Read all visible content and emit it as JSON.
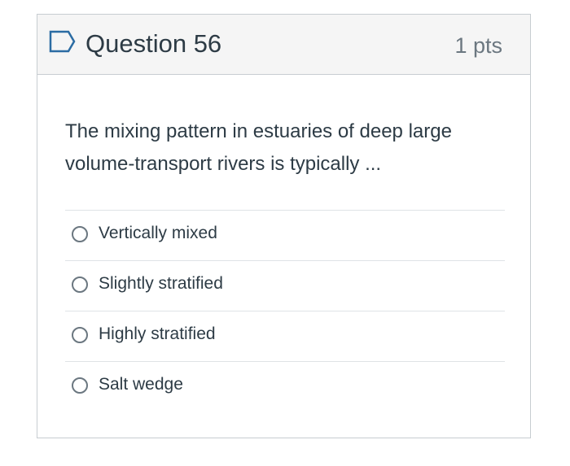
{
  "question": {
    "title": "Question 56",
    "points": "1 pts",
    "flag_icon": "bookmark-flag-icon",
    "text": "The mixing pattern in estuaries of deep large volume-transport rivers is typically ...",
    "answers": [
      {
        "label": "Vertically mixed",
        "selected": false
      },
      {
        "label": "Slightly stratified",
        "selected": false
      },
      {
        "label": "Highly stratified",
        "selected": false
      },
      {
        "label": "Salt wedge",
        "selected": false
      }
    ]
  },
  "colors": {
    "header_bg": "#f5f5f5",
    "border": "#c7cdd1",
    "flag_stroke": "#2b6ca3",
    "text": "#2d3b45",
    "muted": "#6b7780"
  }
}
